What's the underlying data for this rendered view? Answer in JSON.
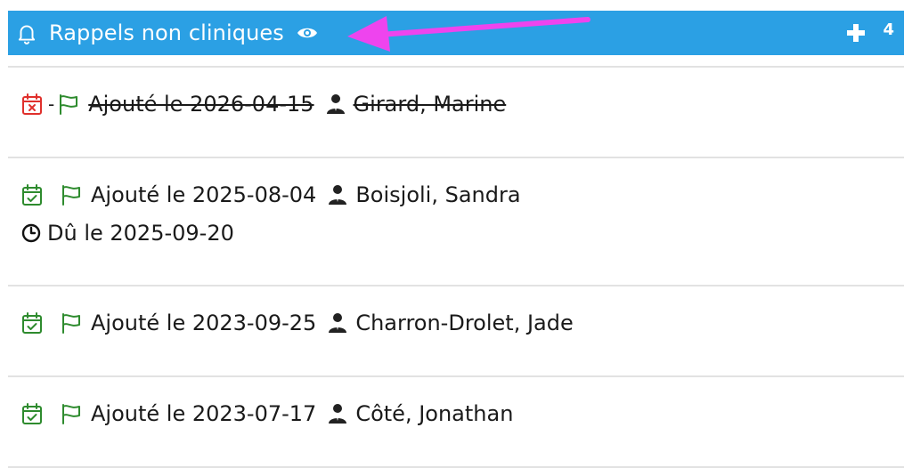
{
  "header": {
    "title": "Rappels non cliniques",
    "count": "4",
    "color": "#2ba0e4",
    "icons": {
      "bell": "bell-icon",
      "eye": "eye-icon",
      "add": "plus-icon"
    }
  },
  "annotation": {
    "arrow_color": "#ee44ee"
  },
  "reminders": [
    {
      "status": "cancelled",
      "separator": "-",
      "added": "Ajouté le 2026-04-15",
      "author": "Girard, Marine",
      "due": null
    },
    {
      "status": "done",
      "separator": "",
      "added": "Ajouté le 2025-08-04",
      "author": "Boisjoli, Sandra",
      "due": "Dû le 2025-09-20"
    },
    {
      "status": "done",
      "separator": "",
      "added": "Ajouté le 2023-09-25",
      "author": "Charron-Drolet, Jade",
      "due": null
    },
    {
      "status": "done",
      "separator": "",
      "added": "Ajouté le 2023-07-17",
      "author": "Côté, Jonathan",
      "due": null
    }
  ],
  "colors": {
    "cancelled": "#e0302c",
    "done": "#2e8b2e",
    "flag": "#2e8b2e"
  }
}
